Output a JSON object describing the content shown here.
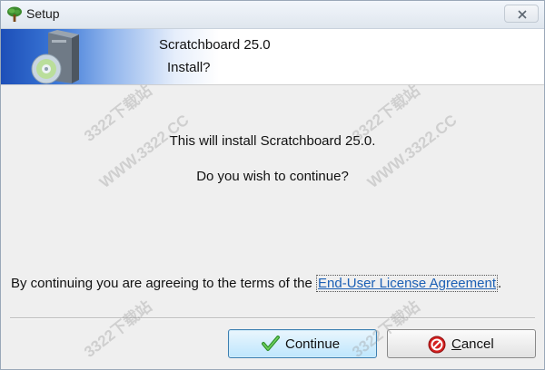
{
  "window": {
    "title": "Setup",
    "close_icon": "close-icon"
  },
  "header": {
    "app_name": "Scratchboard 25.0",
    "subtitle": "Install?",
    "icon": "installer-disc-icon"
  },
  "body": {
    "message": "This will install Scratchboard 25.0.",
    "question": "Do you wish to continue?",
    "agreement_prefix": "By continuing you are agreeing to the terms of the ",
    "eula_link": "End-User License Agreement",
    "agreement_suffix": "."
  },
  "buttons": {
    "continue_label": "Continue",
    "cancel_prefix": "",
    "cancel_accel": "C",
    "cancel_rest": "ancel"
  },
  "watermark": {
    "site": "WWW.3322.CC",
    "brand": "3322下载站"
  },
  "colors": {
    "link": "#1b5fb5",
    "continue_icon": "#3aa53a",
    "cancel_icon": "#d42020"
  }
}
